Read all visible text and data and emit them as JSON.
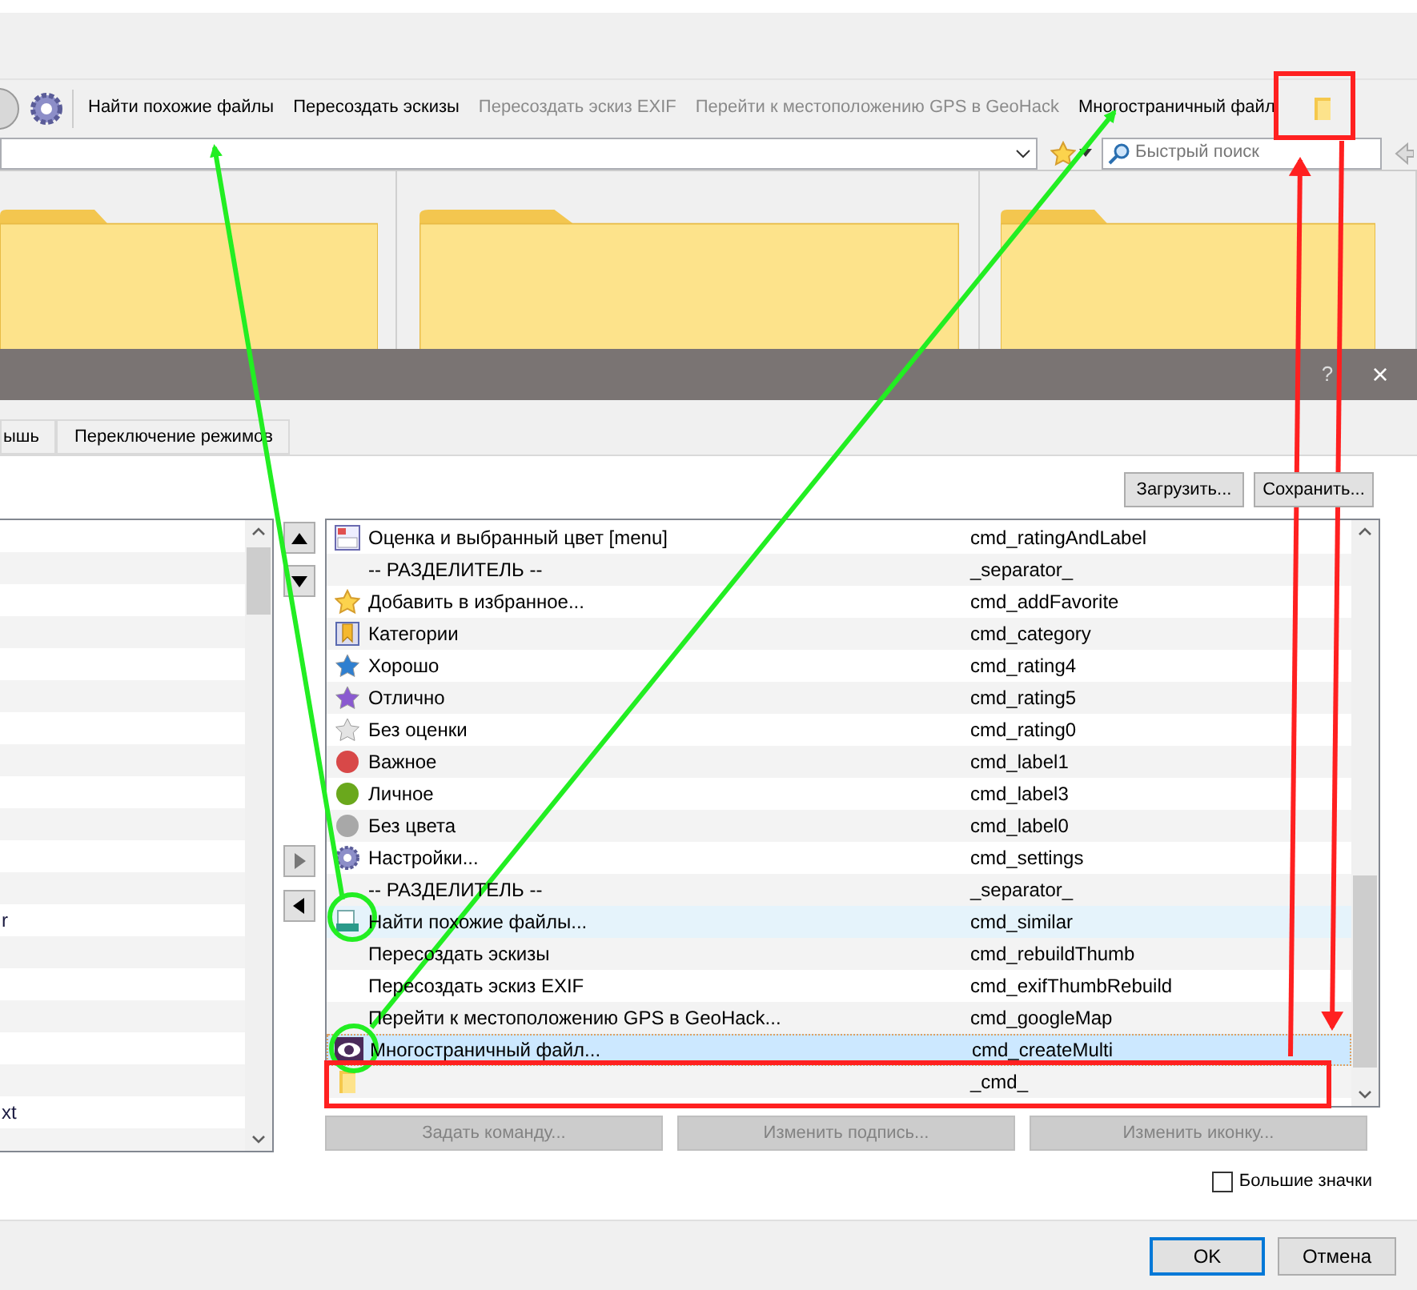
{
  "toolbar": {
    "buttons": [
      {
        "label": "Найти похожие файлы",
        "disabled": false
      },
      {
        "label": "Пересоздать эскизы",
        "disabled": false
      },
      {
        "label": "Пересоздать эскиз EXIF",
        "disabled": true
      },
      {
        "label": "Перейти к местоположению GPS в GeoHack",
        "disabled": true
      },
      {
        "label": "Многостраничный файл",
        "disabled": false
      }
    ]
  },
  "search": {
    "placeholder": "Быстрый поиск"
  },
  "thumbnails": [
    {
      "kind": "folder"
    },
    {
      "kind": "folder"
    },
    {
      "kind": "folder"
    }
  ],
  "dialog": {
    "help": "?",
    "close": "×",
    "tabs": [
      {
        "label": "ышь",
        "selected": false
      },
      {
        "label": "Переключение режимов",
        "selected": false
      }
    ],
    "load_button": "Загрузить...",
    "save_button": "Сохранить...",
    "left_list": [
      {
        "text": "r"
      },
      {
        "text": "xt"
      }
    ],
    "commands": [
      {
        "kind": "rating",
        "name": "Оценка и выбранный цвет [menu]",
        "command": "cmd_ratingAndLabel",
        "selected": false,
        "highlighted": false
      },
      {
        "kind": "blank",
        "name": "-- РАЗДЕЛИТЕЛЬ --",
        "command": "_separator_",
        "selected": false,
        "highlighted": false
      },
      {
        "kind": "favorite",
        "name": "Добавить в избранное...",
        "command": "cmd_addFavorite",
        "selected": false,
        "highlighted": false
      },
      {
        "kind": "category",
        "name": "Категории",
        "command": "cmd_category",
        "selected": false,
        "highlighted": false
      },
      {
        "kind": "star",
        "name": "Хорошо",
        "command": "cmd_rating4",
        "selected": false,
        "highlighted": false,
        "color": "#2f7fd0"
      },
      {
        "kind": "star",
        "name": "Отлично",
        "command": "cmd_rating5",
        "selected": false,
        "highlighted": false,
        "color": "#8a5ad0"
      },
      {
        "kind": "star",
        "name": "Без оценки",
        "command": "cmd_rating0",
        "selected": false,
        "highlighted": false,
        "color": "#e4e4e4"
      },
      {
        "kind": "dot",
        "name": "Важное",
        "command": "cmd_label1",
        "selected": false,
        "highlighted": false,
        "color": "#d84848"
      },
      {
        "kind": "dot",
        "name": "Личное",
        "command": "cmd_label3",
        "selected": false,
        "highlighted": false,
        "color": "#6aa81c"
      },
      {
        "kind": "dot",
        "name": "Без цвета",
        "command": "cmd_label0",
        "selected": false,
        "highlighted": false,
        "color": "#a8a8a8"
      },
      {
        "kind": "settings",
        "name": "Настройки...",
        "command": "cmd_settings",
        "selected": false,
        "highlighted": false
      },
      {
        "kind": "blank",
        "name": "-- РАЗДЕЛИТЕЛЬ --",
        "command": "_separator_",
        "selected": false,
        "highlighted": false
      },
      {
        "kind": "similar",
        "name": "Найти похожие файлы...",
        "command": "cmd_similar",
        "selected": false,
        "highlighted": true
      },
      {
        "kind": "blank",
        "name": "Пересоздать эскизы",
        "command": "cmd_rebuildThumb",
        "selected": false,
        "highlighted": false
      },
      {
        "kind": "blank",
        "name": "Пересоздать эскиз EXIF",
        "command": "cmd_exifThumbRebuild",
        "selected": false,
        "highlighted": false
      },
      {
        "kind": "blank",
        "name": "Перейти к местоположению GPS в GeoHack...",
        "command": "cmd_googleMap",
        "selected": false,
        "highlighted": false
      },
      {
        "kind": "multi",
        "name": "Многостраничный файл...",
        "command": "cmd_createMulti",
        "selected": true,
        "highlighted": false
      },
      {
        "kind": "folder",
        "command": "_cmd_",
        "selected": false,
        "highlighted": false
      }
    ],
    "action_buttons": [
      {
        "label": "Задать команду...",
        "disabled": true
      },
      {
        "label": "Изменить подпись...",
        "disabled": true
      },
      {
        "label": "Изменить иконку...",
        "disabled": true
      }
    ],
    "large_icons": {
      "label": "Большие значки",
      "checked": false
    },
    "ok": "OK",
    "cancel": "Отмена"
  }
}
